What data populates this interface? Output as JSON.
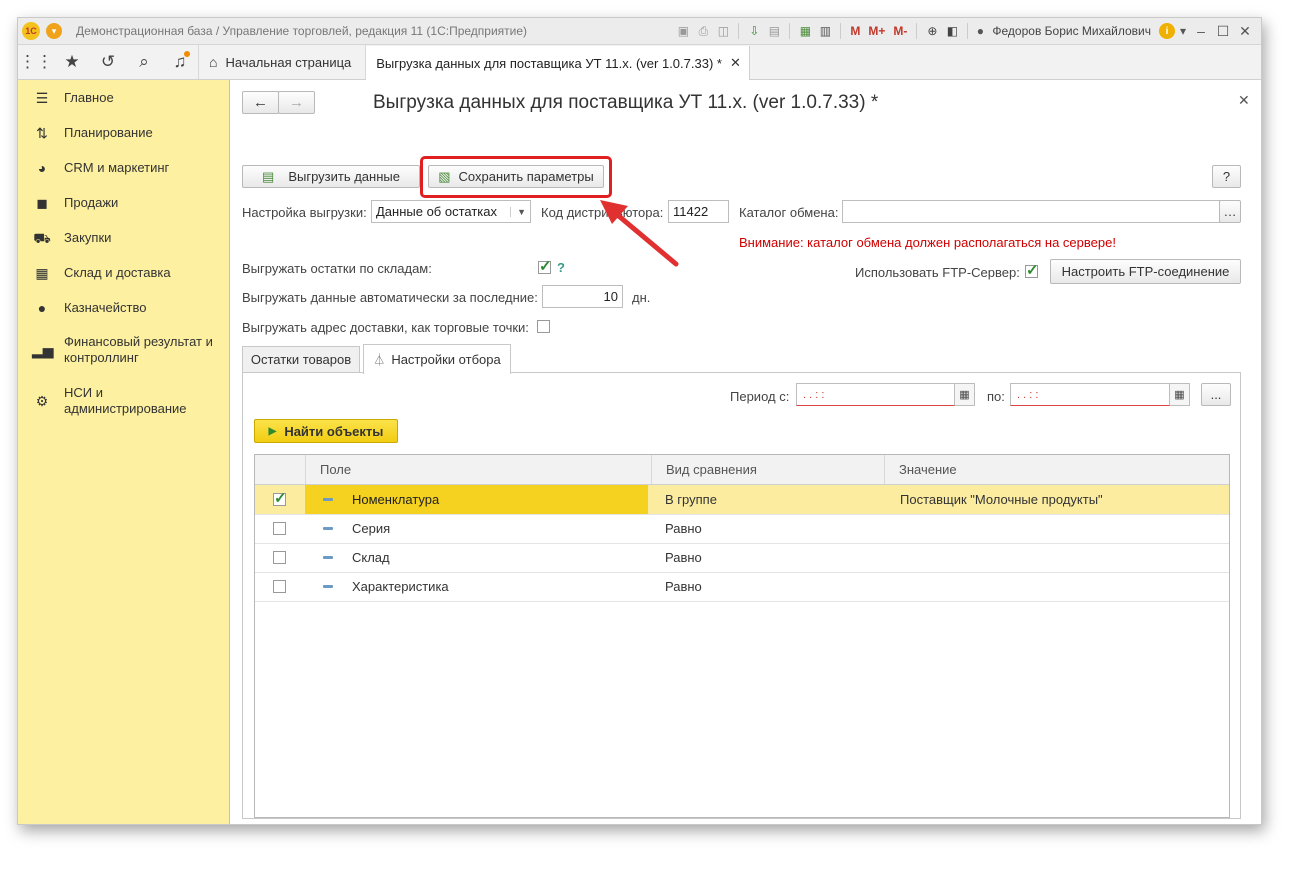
{
  "window": {
    "title": "Демонстрационная база / Управление торговлей, редакция 11  (1С:Предприятие)",
    "user": "Федоров Борис Михайлович",
    "toolbar_m": "M",
    "toolbar_mplus": "M+",
    "toolbar_mminus": "M-"
  },
  "navbar": {
    "home_tab": "Начальная страница",
    "active_tab": "Выгрузка данных для поставщика УТ 11.x. (ver 1.0.7.33) *"
  },
  "sidebar": {
    "items": [
      {
        "label": "Главное",
        "icon": "menu-lines-icon"
      },
      {
        "label": "Планирование",
        "icon": "planning-icon"
      },
      {
        "label": "CRM и маркетинг",
        "icon": "pie-chart-icon"
      },
      {
        "label": "Продажи",
        "icon": "shopping-bag-icon"
      },
      {
        "label": "Закупки",
        "icon": "cart-icon"
      },
      {
        "label": "Склад и доставка",
        "icon": "warehouse-icon"
      },
      {
        "label": "Казначейство",
        "icon": "ruble-icon"
      },
      {
        "label": "Финансовый результат и контроллинг",
        "icon": "bar-chart-icon"
      },
      {
        "label": "НСИ и администрирование",
        "icon": "gear-icon"
      }
    ]
  },
  "form": {
    "title": "Выгрузка данных для поставщика УТ 11.x. (ver 1.0.7.33) *",
    "export_button": "Выгрузить данные",
    "save_params_button": "Сохранить параметры",
    "help_button": "?",
    "setting_label": "Настройка выгрузки:",
    "setting_value": "Данные об остатках",
    "distributor_label": "Код дистрибьютора:",
    "distributor_value": "11422",
    "catalog_label": "Каталог обмена:",
    "catalog_value": "",
    "warning": "Внимание: каталог обмена должен располагаться на сервере!",
    "by_warehouse_label": "Выгружать остатки по складам:",
    "by_warehouse_checked": true,
    "by_warehouse_help": "?",
    "ftp_label": "Использовать FTP-Сервер:",
    "ftp_checked": true,
    "ftp_button": "Настроить FTP-соединение",
    "auto_label": "Выгружать данные автоматически за последние:",
    "auto_value": "10",
    "auto_unit": "дн.",
    "address_label": "Выгружать адрес доставки, как торговые точки:",
    "address_checked": false
  },
  "tabs": [
    {
      "label": "Остатки товаров",
      "active": false
    },
    {
      "label": "Настройки отбора",
      "active": true
    }
  ],
  "filter": {
    "period_from_label": "Период с:",
    "period_to_label": "по:",
    "period_from_value": "  .  .       :  :",
    "period_to_value": "  .  .       :  :",
    "more_button": "...",
    "find_button": "Найти объекты"
  },
  "grid": {
    "columns": [
      "Поле",
      "Вид сравнения",
      "Значение"
    ],
    "rows": [
      {
        "checked": true,
        "field": "Номенклатура",
        "comparison": "В группе",
        "value": "Поставщик \"Молочные продукты\""
      },
      {
        "checked": false,
        "field": "Серия",
        "comparison": "Равно",
        "value": ""
      },
      {
        "checked": false,
        "field": "Склад",
        "comparison": "Равно",
        "value": ""
      },
      {
        "checked": false,
        "field": "Характеристика",
        "comparison": "Равно",
        "value": ""
      }
    ]
  }
}
